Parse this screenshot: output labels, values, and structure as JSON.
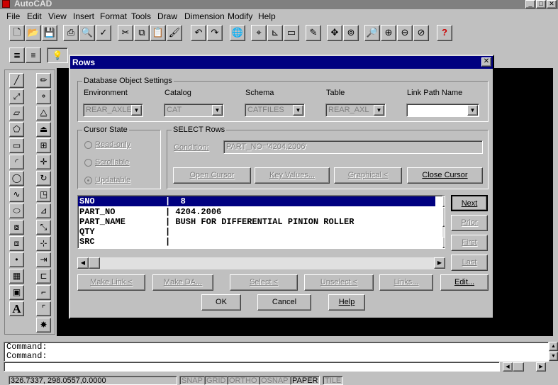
{
  "app": {
    "title": "AutoCAD"
  },
  "menu": [
    "File",
    "Edit",
    "View",
    "Insert",
    "Format",
    "Tools",
    "Draw",
    "Dimension",
    "Modify",
    "Help"
  ],
  "dialog": {
    "title": "Rows",
    "db_settings": {
      "legend": "Database Object Settings",
      "environment": {
        "label": "Environment",
        "value": "REAR_AXLE"
      },
      "catalog": {
        "label": "Catalog",
        "value": "CAT"
      },
      "schema": {
        "label": "Schema",
        "value": "CATFILES"
      },
      "table": {
        "label": "Table",
        "value": "REAR_AXL"
      },
      "link_path": {
        "label": "Link Path Name",
        "value": ""
      }
    },
    "cursor_state": {
      "legend": "Cursor State",
      "options": [
        "Read-only",
        "Scrollable",
        "Updatable"
      ],
      "selected": "Updatable"
    },
    "select_rows": {
      "legend": "SELECT Rows",
      "condition_label": "Condition:",
      "condition_value": "PART_NO='4204.2006'"
    },
    "buttons": {
      "open_cursor": "Open Cursor",
      "key_values": "Key Values...",
      "graphical": "Graphical <",
      "close_cursor": "Close Cursor",
      "next": "Next",
      "prior": "Prior",
      "first": "First",
      "last": "Last",
      "make_link": "Make Link <",
      "make_da": "Make DA...",
      "select": "Select <",
      "unselect": "Unselect <",
      "links": "Links...",
      "edit": "Edit...",
      "ok": "OK",
      "cancel": "Cancel",
      "help": "Help"
    },
    "rows": [
      {
        "field": "SNO",
        "value": "8"
      },
      {
        "field": "PART_NO",
        "value": "4204.2006"
      },
      {
        "field": "PART_NAME",
        "value": "BUSH FOR DIFFERENTIAL PINION ROLLER"
      },
      {
        "field": "QTY",
        "value": ""
      },
      {
        "field": "SRC",
        "value": ""
      }
    ]
  },
  "command": {
    "lines": [
      "Command:",
      "Command:"
    ]
  },
  "status": {
    "coords": "326.7337, 298.0557,0.0000",
    "toggles": [
      "SNAP",
      "GRID",
      "ORTHO",
      "OSNAP",
      "PAPER",
      "TILE"
    ],
    "active": "PAPER"
  }
}
